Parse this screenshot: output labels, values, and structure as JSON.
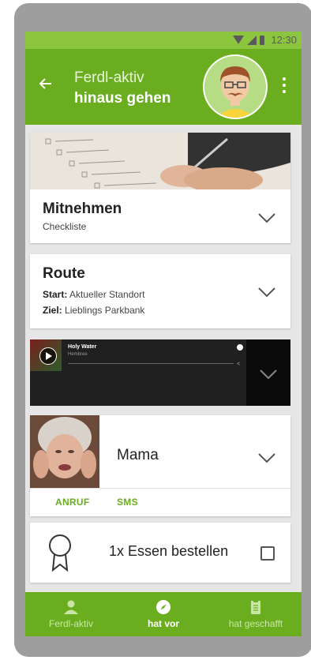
{
  "status_bar": {
    "time": "12:30",
    "icons": [
      "wifi-icon",
      "signal-icon",
      "battery-icon"
    ]
  },
  "app_bar": {
    "back_icon": "arrow-left-icon",
    "subtitle": "Ferdl-aktiv",
    "title": "hinaus gehen",
    "menu_icon": "more-vert-icon",
    "color": "#6aae20"
  },
  "cards": {
    "mitnehmen": {
      "title": "Mitnehmen",
      "subtitle": "Checkliste"
    },
    "route": {
      "title": "Route",
      "start_label": "Start:",
      "start_value": "Aktueller Standort",
      "ziel_label": "Ziel:",
      "ziel_value": "Lieblings Parkbank"
    },
    "music": {
      "track": "Holy Water",
      "artist": "Hembree"
    },
    "contact": {
      "name": "Mama",
      "call_label": "ANRUF",
      "sms_label": "SMS"
    },
    "task": {
      "text": "1x Essen bestellen",
      "checked": false
    }
  },
  "bottom_nav": {
    "items": [
      {
        "label": "Ferdl-aktiv",
        "icon": "person-icon",
        "active": false
      },
      {
        "label": "hat vor",
        "icon": "compass-icon",
        "active": true
      },
      {
        "label": "hat geschafft",
        "icon": "clipboard-icon",
        "active": false
      }
    ]
  }
}
